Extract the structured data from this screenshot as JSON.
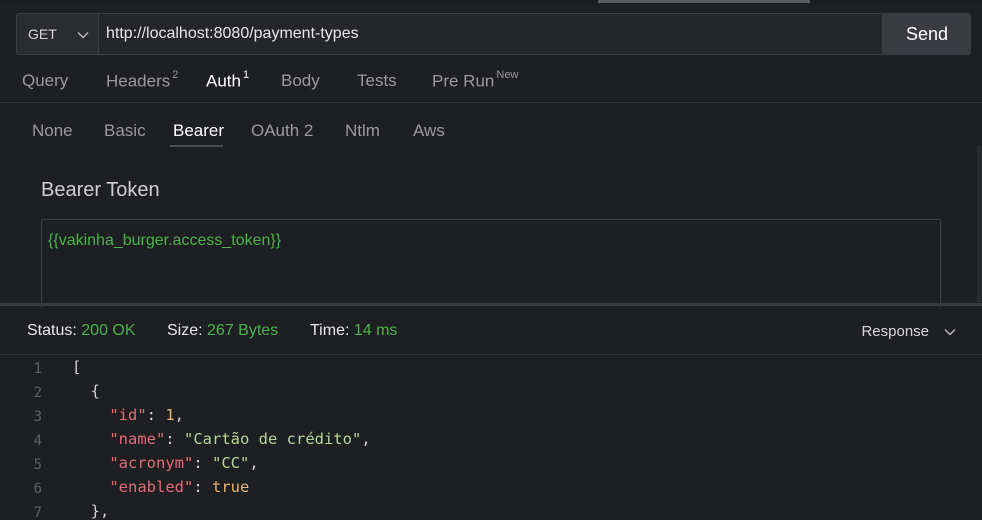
{
  "request": {
    "method": "GET",
    "url": "http://localhost:8080/payment-types",
    "send_label": "Send"
  },
  "tabs": [
    {
      "label": "Query",
      "badge": ""
    },
    {
      "label": "Headers",
      "badge": "2"
    },
    {
      "label": "Auth",
      "badge": "1"
    },
    {
      "label": "Body",
      "badge": ""
    },
    {
      "label": "Tests",
      "badge": ""
    },
    {
      "label": "Pre Run",
      "badge": "New"
    }
  ],
  "active_tab": "Auth",
  "auth": {
    "types": [
      "None",
      "Basic",
      "Bearer",
      "OAuth 2",
      "Ntlm",
      "Aws"
    ],
    "active_type": "Bearer",
    "bearer_label": "Bearer Token",
    "token": "{{vakinha_burger.access_token}}"
  },
  "response": {
    "status_label": "Status:",
    "status_value": "200 OK",
    "size_label": "Size:",
    "size_value": "267 Bytes",
    "time_label": "Time:",
    "time_value": "14 ms",
    "view_label": "Response"
  },
  "code_lines": [
    {
      "n": "1"
    },
    {
      "n": "2"
    },
    {
      "n": "3",
      "key": "\"id\"",
      "val": "1",
      "trail": ","
    },
    {
      "n": "4",
      "key": "\"name\"",
      "val": "\"Cartão de crédito\"",
      "trail": ","
    },
    {
      "n": "5",
      "key": "\"acronym\"",
      "val": "\"CC\"",
      "trail": ","
    },
    {
      "n": "6",
      "key": "\"enabled\"",
      "val": "true",
      "trail": ""
    },
    {
      "n": "7"
    }
  ],
  "colors": {
    "accent_green": "#4ab34a",
    "json_key": "#e06c75",
    "json_string": "#b5d59a",
    "json_number": "#e6b673"
  }
}
